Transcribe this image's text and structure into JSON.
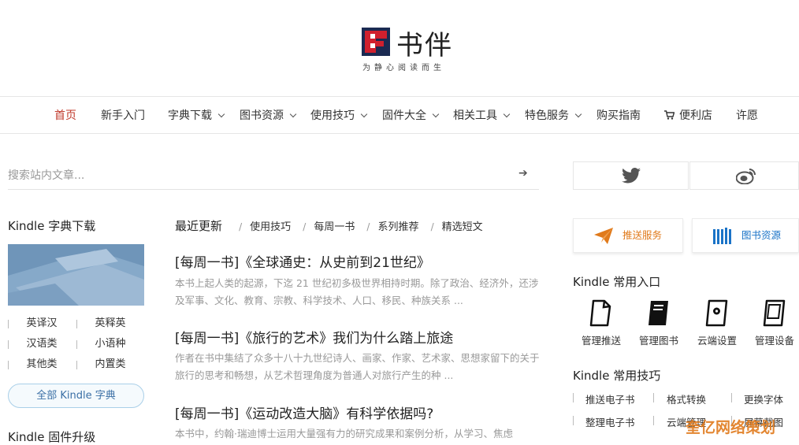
{
  "site": {
    "title": "书伴",
    "slogan": "为静心阅读而生"
  },
  "nav": [
    {
      "label": "首页",
      "active": true,
      "dropdown": false
    },
    {
      "label": "新手入门",
      "dropdown": false
    },
    {
      "label": "字典下载",
      "dropdown": true
    },
    {
      "label": "图书资源",
      "dropdown": true
    },
    {
      "label": "使用技巧",
      "dropdown": true
    },
    {
      "label": "固件大全",
      "dropdown": true
    },
    {
      "label": "相关工具",
      "dropdown": true
    },
    {
      "label": "特色服务",
      "dropdown": true
    },
    {
      "label": "购买指南",
      "dropdown": false
    },
    {
      "label": "便利店",
      "dropdown": false,
      "icon": "cart-icon"
    },
    {
      "label": "许愿",
      "dropdown": false
    }
  ],
  "search": {
    "placeholder": "搜索站内文章..."
  },
  "left_sidebar": {
    "dict_title": "Kindle 字典下载",
    "dict_items": [
      "英译汉",
      "英释英",
      "汉语类",
      "小语种",
      "其他类",
      "内置类"
    ],
    "all_dict": "全部 Kindle 字典",
    "firmware_title": "Kindle 固件升级"
  },
  "main": {
    "tabs": [
      "最近更新",
      "使用技巧",
      "每周一书",
      "系列推荐",
      "精选短文"
    ],
    "articles": [
      {
        "title": "[每周一书]《全球通史：从史前到21世纪》",
        "excerpt": "本书上起人类的起源，下迄 21 世纪初多极世界相持时期。除了政治、经济外，还涉及军事、文化、教育、宗教、科学技术、人口、移民、种族关系 ..."
      },
      {
        "title": "[每周一书]《旅行的艺术》我们为什么踏上旅途",
        "excerpt": "作者在书中集结了众多十八十九世纪诗人、画家、作家、艺术家、思想家留下的关于旅行的思考和畅想，从艺术哲理角度为普通人对旅行产生的种 ..."
      },
      {
        "title": "[每周一书]《运动改造大脑》有科学依据吗?",
        "excerpt": "本书中，约翰·瑞迪博士运用大量强有力的研究成果和案例分析，从学习、焦虑"
      }
    ]
  },
  "right_sidebar": {
    "social": [
      "twitter-icon",
      "weibo-icon"
    ],
    "promos": [
      "推送服务",
      "图书资源"
    ],
    "entry_title": "Kindle 常用入口",
    "entries": [
      "管理推送",
      "管理图书",
      "云端设置",
      "管理设备"
    ],
    "tips_title": "Kindle 常用技巧",
    "tips": [
      "推送电子书",
      "格式转换",
      "更换字体",
      "整理电子书",
      "云端管理",
      "屏幕截图"
    ]
  },
  "watermark": "奎亿网络策划",
  "colors": {
    "accent": "#c0392b",
    "link_blue": "#3a6fa5",
    "orange": "#e07a1b",
    "blue": "#1a73c7"
  }
}
